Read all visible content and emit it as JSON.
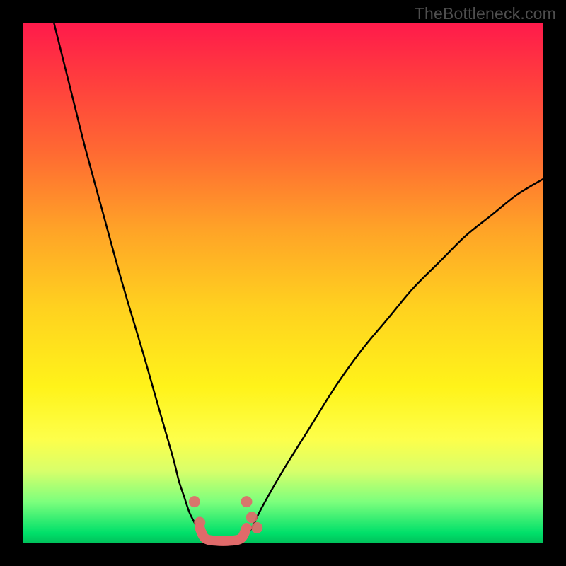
{
  "watermark": "TheBottleneck.com",
  "colors": {
    "background": "#000000",
    "curve": "#000000",
    "marker": "#e06a6a",
    "gradient_top": "#ff1a4b",
    "gradient_bottom": "#00c05a"
  },
  "chart_data": {
    "type": "line",
    "title": "",
    "xlabel": "",
    "ylabel": "",
    "xlim": [
      0,
      100
    ],
    "ylim": [
      0,
      100
    ],
    "series": [
      {
        "name": "left-curve",
        "x": [
          6,
          8,
          10,
          12,
          15,
          18,
          20,
          23,
          25,
          27,
          29,
          30,
          31,
          32,
          33,
          34,
          35
        ],
        "y": [
          100,
          92,
          84,
          76,
          65,
          54,
          47,
          37,
          30,
          23,
          16,
          12,
          9,
          6,
          4,
          2,
          0
        ]
      },
      {
        "name": "right-curve",
        "x": [
          42,
          44,
          46,
          50,
          55,
          60,
          65,
          70,
          75,
          80,
          85,
          90,
          95,
          100
        ],
        "y": [
          0,
          3,
          7,
          14,
          22,
          30,
          37,
          43,
          49,
          54,
          59,
          63,
          67,
          70
        ]
      }
    ],
    "markers": [
      {
        "x": 33,
        "y": 8
      },
      {
        "x": 34,
        "y": 4
      },
      {
        "x": 43,
        "y": 8
      },
      {
        "x": 44,
        "y": 5
      },
      {
        "x": 45,
        "y": 3
      }
    ],
    "trough_path": [
      {
        "x": 34,
        "y": 3
      },
      {
        "x": 35,
        "y": 1
      },
      {
        "x": 37,
        "y": 0.5
      },
      {
        "x": 40,
        "y": 0.5
      },
      {
        "x": 42,
        "y": 1
      },
      {
        "x": 43,
        "y": 3
      }
    ]
  }
}
